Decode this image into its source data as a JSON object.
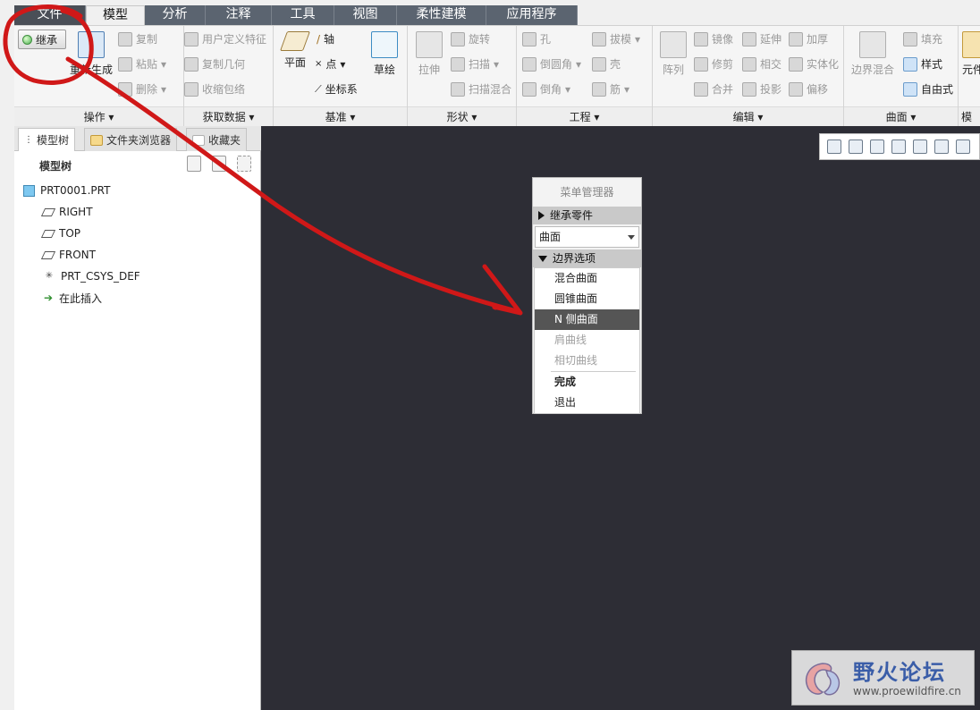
{
  "tabs": [
    {
      "label": "文件"
    },
    {
      "label": "模型"
    },
    {
      "label": "分析"
    },
    {
      "label": "注释"
    },
    {
      "label": "工具"
    },
    {
      "label": "视图"
    },
    {
      "label": "柔性建模"
    },
    {
      "label": "应用程序"
    }
  ],
  "ribbon": {
    "operations": {
      "inherit": "继承",
      "regenerate": "重新生成",
      "copy": "复制",
      "paste": "粘贴",
      "delete": "删除",
      "label": "操作"
    },
    "getdata": {
      "udf": "用户定义特征",
      "copy_geom": "复制几何",
      "shrinkwrap": "收缩包络",
      "label": "获取数据"
    },
    "datum": {
      "plane": "平面",
      "axis": "轴",
      "point": "点",
      "csys": "坐标系",
      "sketch": "草绘",
      "label": "基准"
    },
    "shapes": {
      "extrude": "拉伸",
      "revolve": "旋转",
      "sweep": "扫描",
      "swept_blend": "扫描混合",
      "label": "形状"
    },
    "engineering": {
      "hole": "孔",
      "round": "倒圆角",
      "chamfer": "倒角",
      "draft": "拔模",
      "shell": "壳",
      "rib": "筋",
      "label": "工程"
    },
    "editing": {
      "pattern": "阵列",
      "mirror": "镜像",
      "trim": "修剪",
      "merge": "合并",
      "extend": "延伸",
      "intersect": "相交",
      "project": "投影",
      "thicken": "加厚",
      "solidify": "实体化",
      "offset": "偏移",
      "label": "编辑"
    },
    "surfaces": {
      "boundary_blend": "边界混合",
      "fill": "填充",
      "style": "样式",
      "freestyle": "自由式",
      "label": "曲面"
    },
    "model_intent": {
      "element": "元件",
      "label": "模型"
    }
  },
  "leftpanel": {
    "tabs": [
      {
        "label": "模型树"
      },
      {
        "label": "文件夹浏览器"
      },
      {
        "label": "收藏夹"
      }
    ],
    "tree_header": "模型树",
    "tree": [
      {
        "label": "PRT0001.PRT"
      },
      {
        "label": "RIGHT"
      },
      {
        "label": "TOP"
      },
      {
        "label": "FRONT"
      },
      {
        "label": "PRT_CSYS_DEF"
      },
      {
        "label": "在此插入"
      }
    ]
  },
  "menu": {
    "title": "菜单管理器",
    "section_inherit": "继承零件",
    "select_value": "曲面",
    "section_boundary": "边界选项",
    "items": [
      {
        "label": "混合曲面",
        "state": "normal"
      },
      {
        "label": "圆锥曲面",
        "state": "normal"
      },
      {
        "label": "N 侧曲面",
        "state": "selected"
      },
      {
        "label": "肩曲线",
        "state": "disabled"
      },
      {
        "label": "相切曲线",
        "state": "disabled"
      }
    ],
    "done": "完成",
    "quit": "退出"
  },
  "watermark": {
    "title": "野火论坛",
    "url": "www.proewildfire.cn"
  },
  "colors": {
    "graphics_bg": "#2d2d35",
    "tab_bg": "#5b6470",
    "annotation": "#d01818",
    "selected_item": "#555555"
  }
}
